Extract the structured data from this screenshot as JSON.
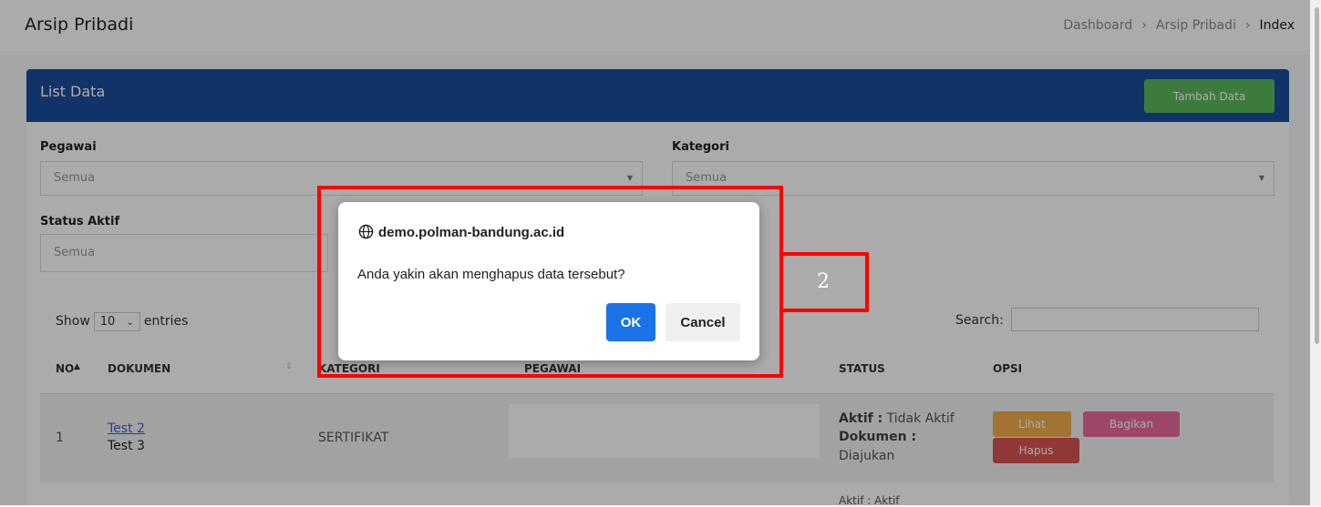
{
  "header": {
    "title": "Arsip Pribadi",
    "breadcrumb": [
      "Dashboard",
      "Arsip Pribadi",
      "Index"
    ]
  },
  "card": {
    "title": "List Data",
    "add_button": "Tambah Data"
  },
  "filters": {
    "pegawai": {
      "label": "Pegawai",
      "value": "Semua"
    },
    "kategori": {
      "label": "Kategori",
      "value": "Semua"
    },
    "status": {
      "label": "Status Aktif",
      "value": "Semua"
    }
  },
  "table_controls": {
    "show": "Show",
    "entries_value": "10",
    "entries": "entries",
    "search_label": "Search:"
  },
  "table": {
    "headers": [
      "NO",
      "DOKUMEN",
      "KATEGORI",
      "PEGAWAI",
      "STATUS",
      "OPSI"
    ],
    "rows": [
      {
        "no": "1",
        "doc_link": "Test 2",
        "doc_sub": "Test 3",
        "kategori": "SERTIFIKAT",
        "aktif_label": "Aktif :",
        "aktif_value": "Tidak Aktif",
        "dokumen_label": "Dokumen :",
        "dokumen_value": "Diajukan",
        "actions": [
          "Lihat",
          "Bagikan",
          "Hapus"
        ]
      }
    ],
    "row2_partial": "Aktif : Aktif"
  },
  "dialog": {
    "origin": "demo.polman-bandung.ac.id",
    "message": "Anda yakin akan menghapus data tersebut?",
    "ok": "OK",
    "cancel": "Cancel"
  },
  "annotation": {
    "number": "2"
  },
  "colors": {
    "header_blue": "#1b4d9c",
    "add_green": "#5cb85c",
    "lihat": "#f0ad4e",
    "bagikan": "#e96b9e",
    "hapus": "#d9534f",
    "ok_blue": "#1a73e8",
    "annotation_red": "#ff0000"
  }
}
